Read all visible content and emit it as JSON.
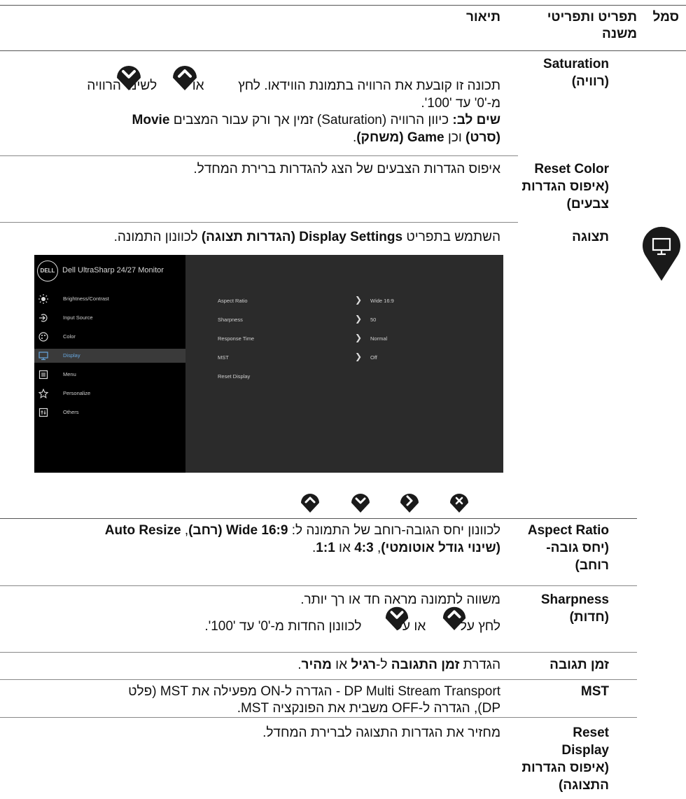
{
  "header": {
    "col_symbol": "סמל",
    "col_menu": "תפריט ותפריטי משנה",
    "col_desc": "תיאור"
  },
  "rows": {
    "saturation": {
      "name": "Saturation",
      "name_he": "(רוויה)",
      "desc_line1_a": "תכונה זו קובעת את הרוויה בתמונת הווידאו. לחץ",
      "desc_line1_b": "או",
      "desc_line1_c": "לשינוי הרוויה",
      "desc_line2": "מ-'0' עד '100'.",
      "note_label": "שים לב:",
      "note_text": "כיוון הרוויה (Saturation) זמין אך ורק עבור המצבים",
      "note_movie": "Movie",
      "note_movie_he": "(סרט)",
      "note_and": "וכן",
      "note_game": "Game (משחק)",
      "note_end": "."
    },
    "reset_color": {
      "name": "Reset Color",
      "name_he_1": "(איפוס הגדרות",
      "name_he_2": "צבעים)",
      "desc": "איפוס הגדרות הצבעים של הצג להגדרות ברירת המחדל."
    },
    "display": {
      "name": "תצוגה",
      "desc_a": "השתמש בתפריט",
      "desc_b": "Display Settings (הגדרות תצוגה)",
      "desc_c": "לכוונון התמונה."
    },
    "aspect_ratio": {
      "name": "Aspect Ratio",
      "name_he_1": "(יחס גובה-",
      "name_he_2": "רוחב)",
      "desc_a": "לכוונון יחס הגובה-רוחב של התמונה ל:",
      "desc_wide": "Wide 16:9 (רחב)",
      "desc_auto": "Auto Resize",
      "desc_auto_he": "(שינוי גודל אוטומטי)",
      "desc_43": "4:3",
      "desc_or": "או",
      "desc_11": "1:1"
    },
    "sharpness": {
      "name": "Sharpness",
      "name_he": "(חדות)",
      "desc1": "משווה לתמונה מראה חד או רך יותר.",
      "desc2_a": "לחץ על",
      "desc2_b": "או על",
      "desc2_c": "לכוונון החדות מ-'0' עד '100'."
    },
    "response_time": {
      "name": "זמן תגובה",
      "desc_a": "הגדרת",
      "desc_b": "זמן התגובה",
      "desc_c": "ל-",
      "desc_d": "רגיל",
      "desc_e": "או",
      "desc_f": "מהיר"
    },
    "mst": {
      "name": "MST",
      "desc_line1": "DP Multi Stream Transport - הגדרה ל-ON מפעילה את MST (פלט",
      "desc_line2": "DP), הגדרה ל-OFF משבית את הפונקציה MST."
    },
    "reset_display": {
      "name_1": "Reset",
      "name_2": "Display",
      "name_he_1": "(איפוס הגדרות",
      "name_he_2": "התצוגה)",
      "desc": "מחזיר את הגדרות התצוגה לברירת המחדל."
    }
  },
  "osd": {
    "logo": "DELL",
    "title": "Dell UltraSharp 24/27 Monitor",
    "menu": [
      "Brightness/Contrast",
      "Input Source",
      "Color",
      "Display",
      "Menu",
      "Personalize",
      "Others"
    ],
    "selected": "Display",
    "settings": [
      {
        "label": "Aspect Ratio",
        "value": "Wide 16:9"
      },
      {
        "label": "Sharpness",
        "value": "50"
      },
      {
        "label": "Response Time",
        "value": "Normal"
      },
      {
        "label": "MST",
        "value": "Off"
      },
      {
        "label": "Reset Display",
        "value": ""
      }
    ]
  },
  "nav_buttons": [
    "up",
    "down",
    "right",
    "close"
  ],
  "colors": {
    "icon": "#1a1a1a",
    "osd_bg": "#2b2b2b",
    "osd_highlight": "#68a8e0"
  }
}
